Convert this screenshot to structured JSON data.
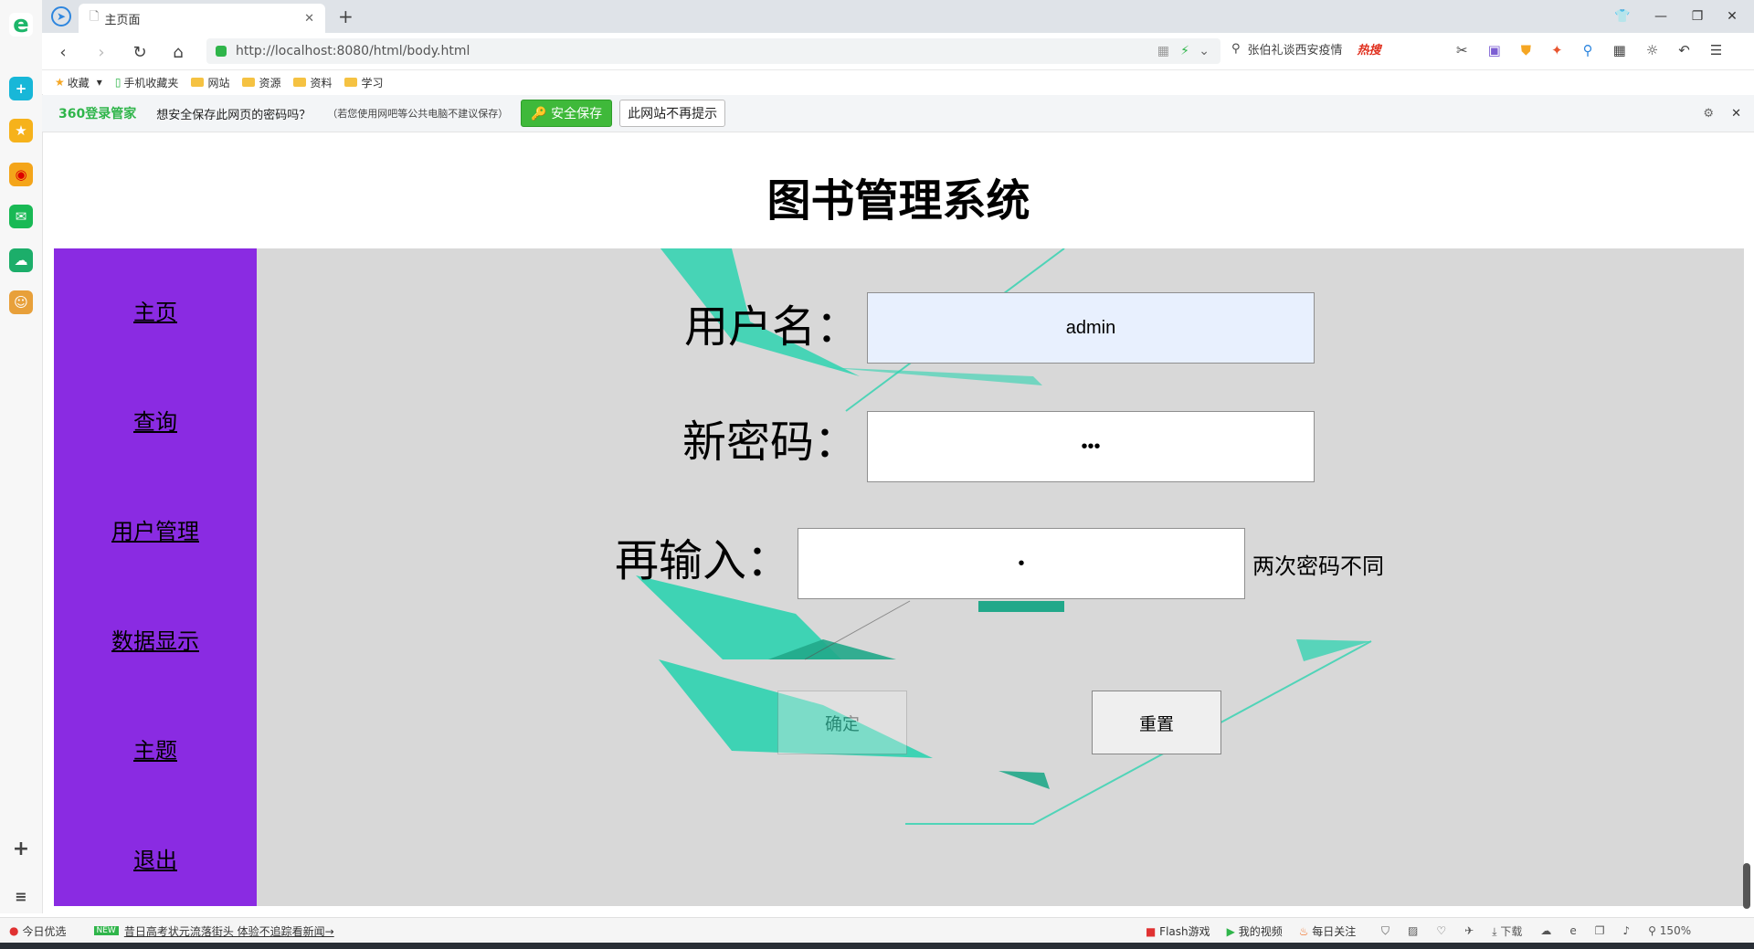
{
  "browser": {
    "tab_title": "主页面",
    "url": "http://localhost:8080/html/body.html",
    "search_hint": "张伯礼谈西安疫情",
    "hot_label": "热搜"
  },
  "bookmarks": [
    "收藏",
    "手机收藏夹",
    "网站",
    "资源",
    "资料",
    "学习"
  ],
  "password_bar": {
    "brand": "360登录管家",
    "prompt": "想安全保存此网页的密码吗？",
    "note": "（若您使用网吧等公共电脑不建议保存）",
    "save_label": "安全保存",
    "never_label": "此网站不再提示"
  },
  "page": {
    "title": "图书管理系统",
    "nav": [
      "主页",
      "查询",
      "用户管理",
      "数据显示",
      "主题",
      "退出"
    ],
    "form": {
      "username_label": "用户名：",
      "username_value": "admin",
      "new_password_label": "新密码：",
      "new_password_mask": "•••",
      "confirm_label": "再输入：",
      "confirm_mask": "•",
      "mismatch_message": "两次密码不同",
      "confirm_button": "确定",
      "reset_button": "重置"
    }
  },
  "status_bar": {
    "left_label": "今日优选",
    "news": "昔日高考状元流落街头  体验不追踪看新闻→",
    "flash": "Flash游戏",
    "video": "我的视频",
    "follow": "每日关注",
    "download": "下载",
    "zoom": "150%"
  },
  "colors": {
    "sidebar": "#8a2be2",
    "main_bg": "#d8d8d8",
    "decor_teal": "#2ed3b0",
    "username_bg": "#e8f0fe",
    "save_green": "#3fb93a"
  }
}
